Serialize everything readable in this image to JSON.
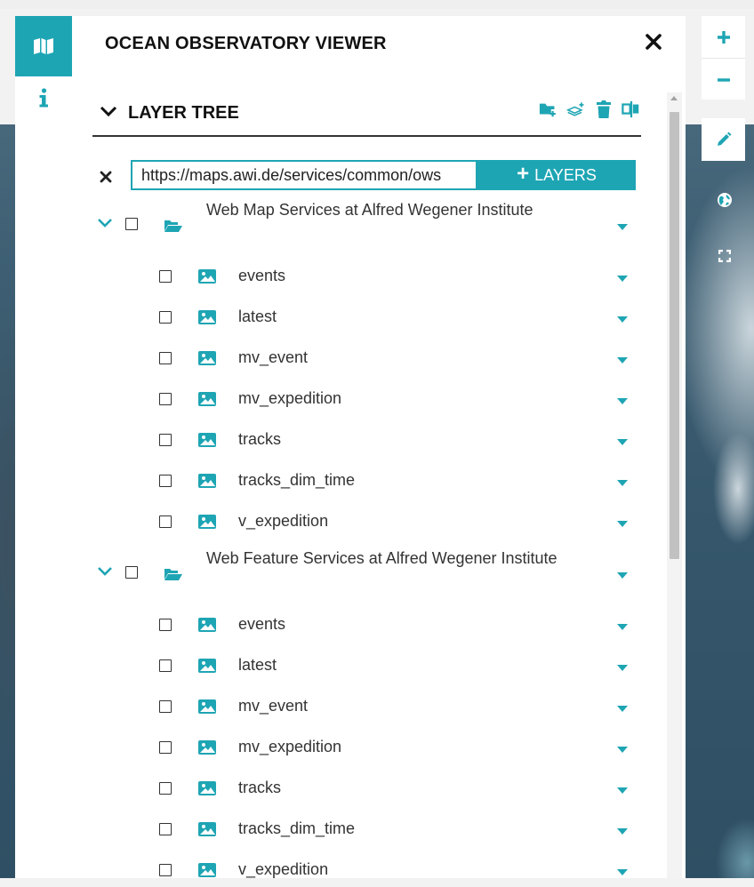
{
  "app": {
    "title": "OCEAN OBSERVATORY VIEWER",
    "accent_color": "#1ea5b4"
  },
  "side_tabs": [
    {
      "name": "map-icon",
      "active": true
    },
    {
      "name": "info-icon",
      "active": false
    }
  ],
  "layer_tree": {
    "title": "LAYER TREE",
    "tools": [
      "add-folder-icon",
      "add-layer-icon",
      "trash-icon",
      "split-icon"
    ]
  },
  "url_bar": {
    "value": "https://maps.awi.de/services/common/ows",
    "add_button_label": "LAYERS"
  },
  "folders": [
    {
      "label": "Web Map Services at Alfred Wegener Institute",
      "layers": [
        "events",
        "latest",
        "mv_event",
        "mv_expedition",
        "tracks",
        "tracks_dim_time",
        "v_expedition"
      ]
    },
    {
      "label": "Web Feature Services at Alfred Wegener Institute",
      "layers": [
        "events",
        "latest",
        "mv_event",
        "mv_expedition",
        "tracks",
        "tracks_dim_time",
        "v_expedition"
      ]
    }
  ],
  "map_controls": [
    "zoom-in-icon",
    "zoom-out-icon",
    "pencil-icon",
    "globe-icon",
    "fullscreen-icon"
  ]
}
